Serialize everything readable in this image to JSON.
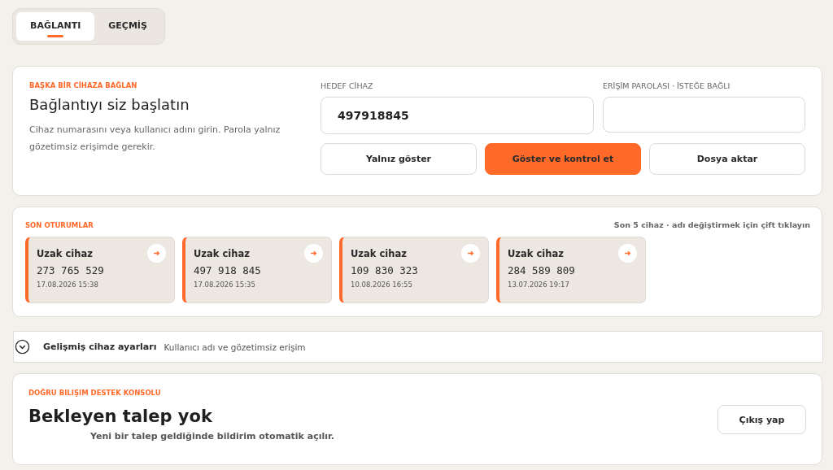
{
  "tabs": [
    {
      "label": "BAĞLANTI",
      "selected": true
    },
    {
      "label": "GEÇMİŞ",
      "selected": false
    }
  ],
  "connect": {
    "eyebrow": "BAŞKA BİR CİHAZA BAĞLAN",
    "title": "Bağlantıyı siz başlatın",
    "description": "Cihaz numarasını veya kullanıcı adını girin. Parola yalnız gözetimsiz erişimde gerekir.",
    "target_label": "HEDEF CİHAZ",
    "target_value": "497918845",
    "password_label": "ERİŞİM PAROLASI · İSTEĞE BAĞLI",
    "buttons": [
      {
        "label": "Yalnız göster",
        "primary": false
      },
      {
        "label": "Göster ve kontrol et",
        "primary": true
      },
      {
        "label": "Dosya aktar",
        "primary": false
      }
    ]
  },
  "recent": {
    "title": "SON OTURUMLAR",
    "hint": "Son 5 cihaz · adı değiştirmek için çift tıklayın",
    "sessions": [
      {
        "name": "Uzak cihaz",
        "id": "273 765 529",
        "time": "17.08.2026 15:38"
      },
      {
        "name": "Uzak cihaz",
        "id": "497 918 845",
        "time": "17.08.2026 15:35"
      },
      {
        "name": "Uzak cihaz",
        "id": "109 830 323",
        "time": "10.08.2026 16:55"
      },
      {
        "name": "Uzak cihaz",
        "id": "284 589 809",
        "time": "13.07.2026 19:17"
      }
    ]
  },
  "advanced": {
    "title": "Gelişmiş cihaz ayarları",
    "subtitle": "Kullanıcı adı ve gözetimsiz erişim",
    "expanded": false
  },
  "console": {
    "eyebrow": "DOĞRU BILIŞIM DESTEK KONSOLU",
    "title": "Bekleyen talep yok",
    "description": "Yeni bir talep geldiğinde bildirim otomatik açılır.",
    "button": "Çıkış yap"
  }
}
